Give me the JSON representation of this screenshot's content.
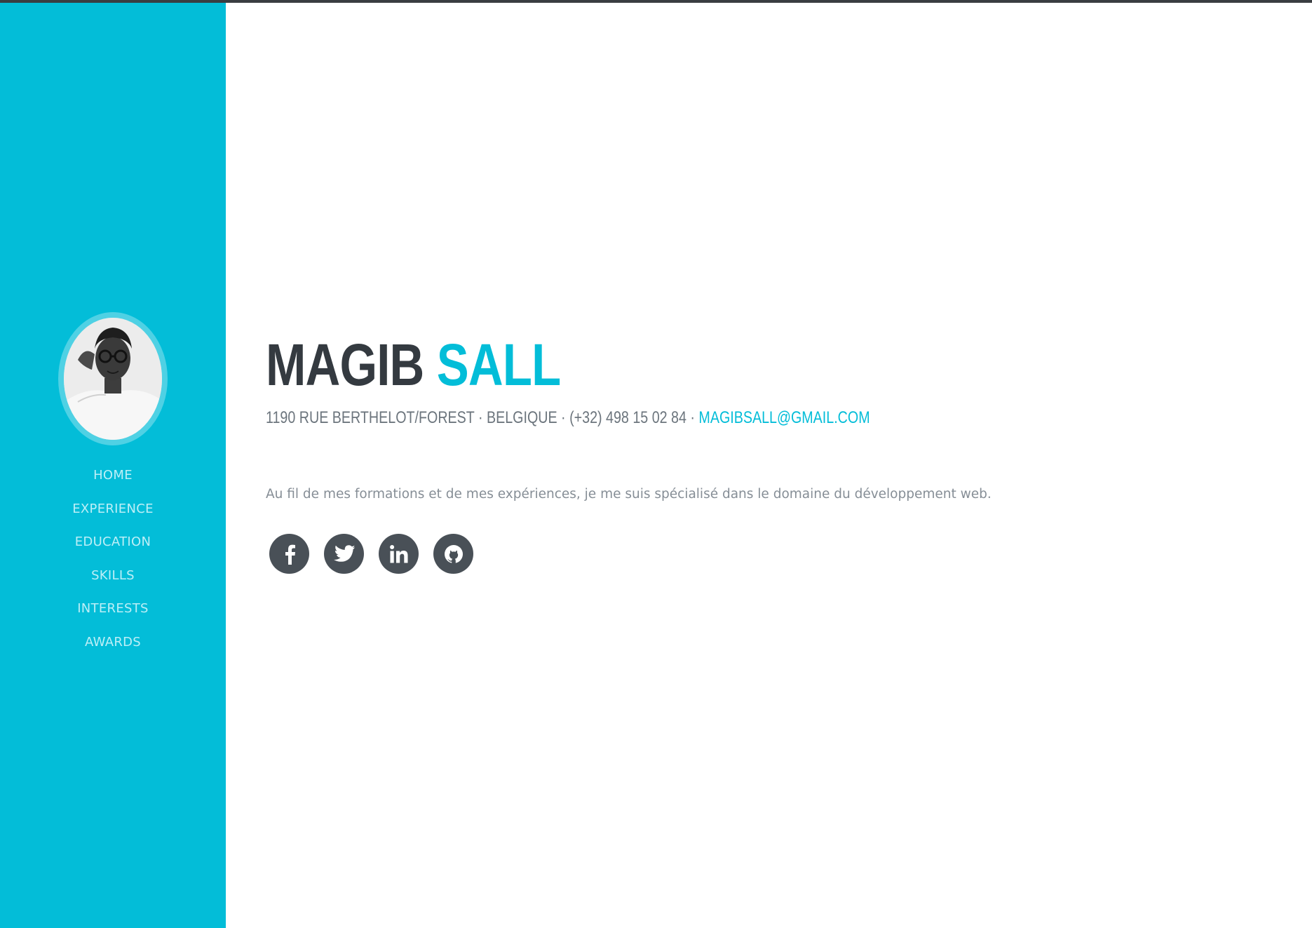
{
  "colors": {
    "primary": "#03bdd8",
    "dark": "#343a40",
    "muted": "#868e96",
    "icon_bg": "#495057",
    "nav_text": "#bdeff7"
  },
  "sidebar": {
    "avatar_alt": "profile photo",
    "nav_items": [
      {
        "label": "HOME"
      },
      {
        "label": "EXPERIENCE"
      },
      {
        "label": "EDUCATION"
      },
      {
        "label": "SKILLS"
      },
      {
        "label": "INTERESTS"
      },
      {
        "label": "AWARDS"
      }
    ]
  },
  "about": {
    "first_name": "MAGIB",
    "last_name": "SALL",
    "address": "1190 RUE BERTHELOT/FOREST · BELGIQUE · (+32) 498 15 02 84 ·",
    "email": "MAGIBSALL@GMAIL.COM",
    "lead": "Au fil de mes formations et de mes expériences, je me suis spécialisé dans le domaine du développement web.",
    "social": [
      {
        "icon": "facebook-icon"
      },
      {
        "icon": "twitter-icon"
      },
      {
        "icon": "linkedin-icon"
      },
      {
        "icon": "github-icon"
      }
    ]
  }
}
